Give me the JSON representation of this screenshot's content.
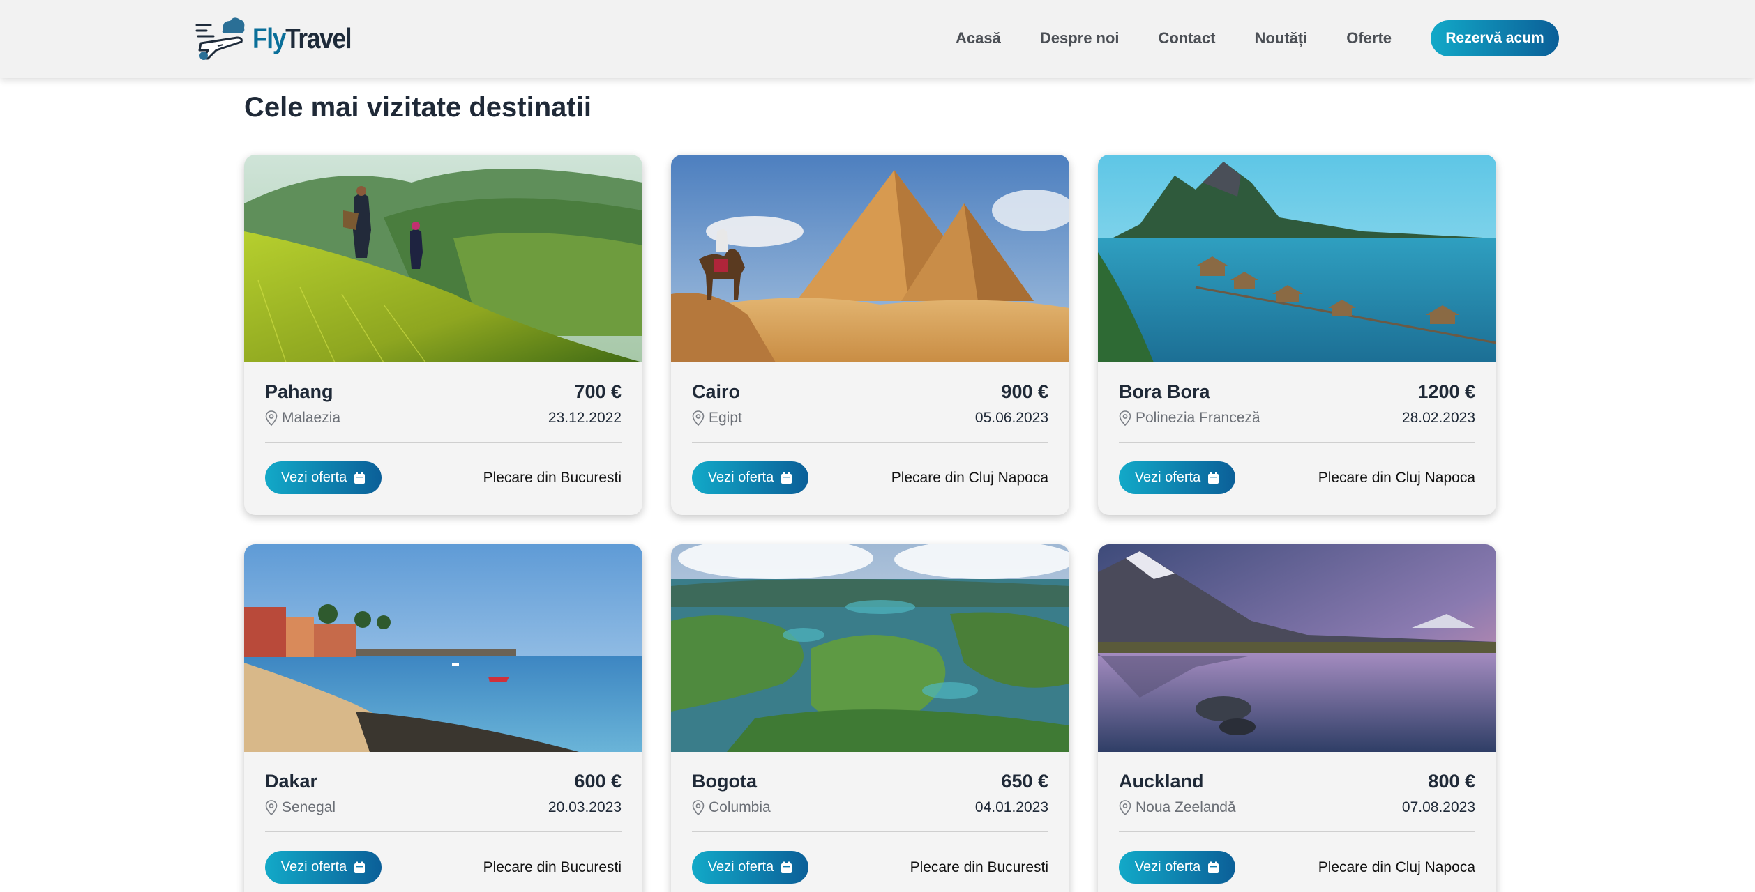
{
  "header": {
    "logo_text": "FlyTravel",
    "logo_text_brand": "Fly",
    "logo_text_rest": "Travel",
    "nav": [
      "Acasă",
      "Despre noi",
      "Contact",
      "Noutăți",
      "Oferte"
    ],
    "cta_label": "Rezervă acum"
  },
  "section": {
    "title": "Cele mai vizitate destinatii"
  },
  "colors": {
    "accent_start": "#12a9c8",
    "accent_end": "#0b5f98",
    "logo_dark": "#1e2b3a"
  },
  "cards": [
    {
      "city": "Pahang",
      "price": "700 €",
      "country": "Malaezia",
      "date": "23.12.2022",
      "button": "Vezi oferta",
      "departure": "Plecare din Bucuresti",
      "image": "rice-terrace-photo"
    },
    {
      "city": "Cairo",
      "price": "900 €",
      "country": "Egipt",
      "date": "05.06.2023",
      "button": "Vezi oferta",
      "departure": "Plecare din Cluj Napoca",
      "image": "pyramids-photo"
    },
    {
      "city": "Bora Bora",
      "price": "1200 €",
      "country": "Polinezia Franceză",
      "date": "28.02.2023",
      "button": "Vezi oferta",
      "departure": "Plecare din Cluj Napoca",
      "image": "lagoon-bungalows-photo"
    },
    {
      "city": "Dakar",
      "price": "600 €",
      "country": "Senegal",
      "date": "20.03.2023",
      "button": "Vezi oferta",
      "departure": "Plecare din Bucuresti",
      "image": "coast-beach-photo"
    },
    {
      "city": "Bogota",
      "price": "650 €",
      "country": "Columbia",
      "date": "04.01.2023",
      "button": "Vezi oferta",
      "departure": "Plecare din Bucuresti",
      "image": "lake-islands-photo"
    },
    {
      "city": "Auckland",
      "price": "800 €",
      "country": "Noua Zeelandă",
      "date": "07.08.2023",
      "button": "Vezi oferta",
      "departure": "Plecare din Cluj Napoca",
      "image": "mountain-lake-photo"
    }
  ]
}
